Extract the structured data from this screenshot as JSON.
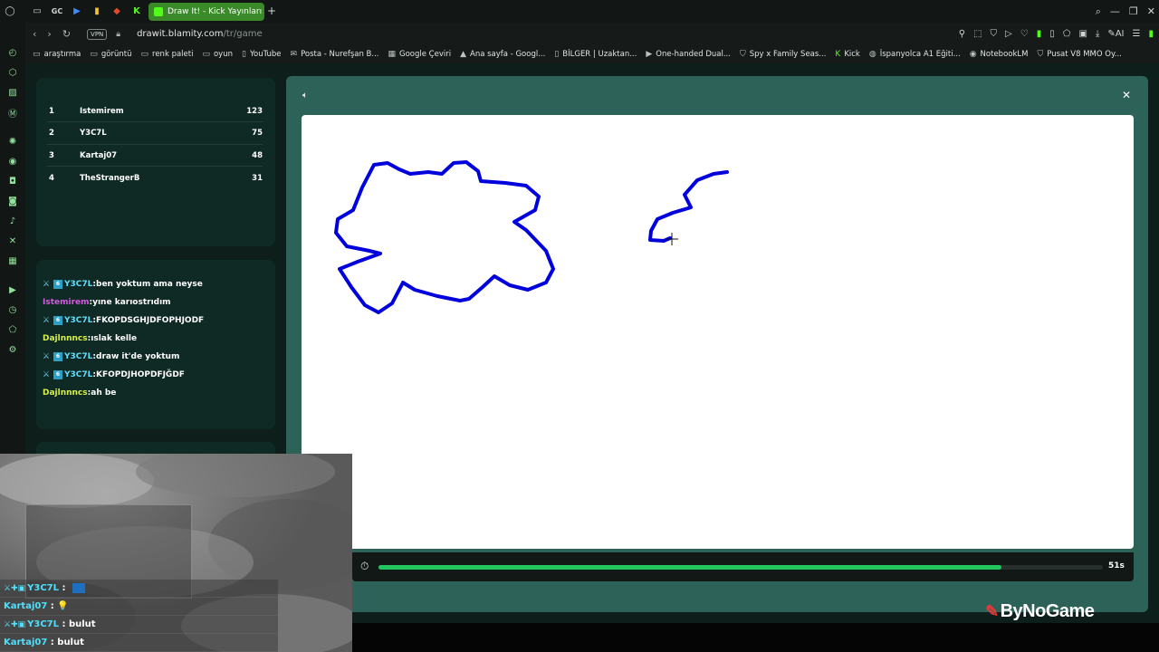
{
  "browser": {
    "tab_title": "Draw It! - Kick Yayınları",
    "tab_icons": [
      "opera-icon",
      "messages-icon",
      "gc-icon",
      "play-icon",
      "bars-icon",
      "red-icon",
      "kick-icon"
    ],
    "gc_label": "GC",
    "new_tab": "+",
    "vpn_label": "VPN",
    "url_host": "drawit.blamity.com",
    "url_path": "/tr/game",
    "ai_label": "AI"
  },
  "bookmarks": [
    {
      "icon": "folder",
      "label": "araştırma"
    },
    {
      "icon": "folder",
      "label": "görüntü"
    },
    {
      "icon": "folder",
      "label": "renk paleti"
    },
    {
      "icon": "folder",
      "label": "oyun"
    },
    {
      "icon": "page",
      "label": "YouTube"
    },
    {
      "icon": "mail",
      "label": "Posta - Nurefşan B..."
    },
    {
      "icon": "translate",
      "label": "Google Çeviri"
    },
    {
      "icon": "drive",
      "label": "Ana sayfa - Googl..."
    },
    {
      "icon": "page",
      "label": "BİLGER | Uzaktan..."
    },
    {
      "icon": "video",
      "label": "One-handed Dual..."
    },
    {
      "icon": "shield",
      "label": "Spy x Family Seas..."
    },
    {
      "icon": "kick",
      "label": "Kick"
    },
    {
      "icon": "globe",
      "label": "İspanyolca A1 Eğiti..."
    },
    {
      "icon": "notebook",
      "label": "NotebookLM"
    },
    {
      "icon": "shield",
      "label": "Pusat V8 MMO Oy..."
    }
  ],
  "leaderboard": [
    {
      "rank": "1",
      "name": "Istemirem",
      "score": "123"
    },
    {
      "rank": "2",
      "name": "Y3C7L",
      "score": "75"
    },
    {
      "rank": "3",
      "name": "Kartaj07",
      "score": "48"
    },
    {
      "rank": "4",
      "name": "TheStrangerB",
      "score": "31"
    }
  ],
  "chat": [
    {
      "user": "Y3C7L",
      "text": "ben yoktum ama neyse",
      "badges": true,
      "color": "cyan"
    },
    {
      "user": "Istemirem",
      "text": "yıne karıostrıdım",
      "badges": false,
      "color": "pink"
    },
    {
      "user": "Y3C7L",
      "text": "FKOPDSGHJDFOPHJODF",
      "badges": true,
      "color": "cyan"
    },
    {
      "user": "Dajlnnncs",
      "text": "ıslak kelle",
      "badges": false,
      "color": "yellow"
    },
    {
      "user": "Y3C7L",
      "text": "draw it'de yoktum",
      "badges": true,
      "color": "cyan"
    },
    {
      "user": "Y3C7L",
      "text": "KFOPDJHOPDFJĞDF",
      "badges": true,
      "color": "cyan"
    },
    {
      "user": "Dajlnnncs",
      "text": "ah be",
      "badges": false,
      "color": "yellow"
    }
  ],
  "game": {
    "timer_text": "51s",
    "timer_progress": 0.86,
    "stroke_color": "#0000dd"
  },
  "branding": {
    "logo_text": "ByNoGame"
  },
  "stream_chat": [
    {
      "user": "Y3C7L",
      "text": "",
      "emote": true,
      "badges": true
    },
    {
      "user": "Kartaj07",
      "text": "💡",
      "emote": false,
      "badges": false
    },
    {
      "user": "Y3C7L",
      "text": "bulut",
      "emote": false,
      "badges": true
    },
    {
      "user": "Kartaj07",
      "text": "bulut",
      "emote": false,
      "badges": false
    }
  ]
}
